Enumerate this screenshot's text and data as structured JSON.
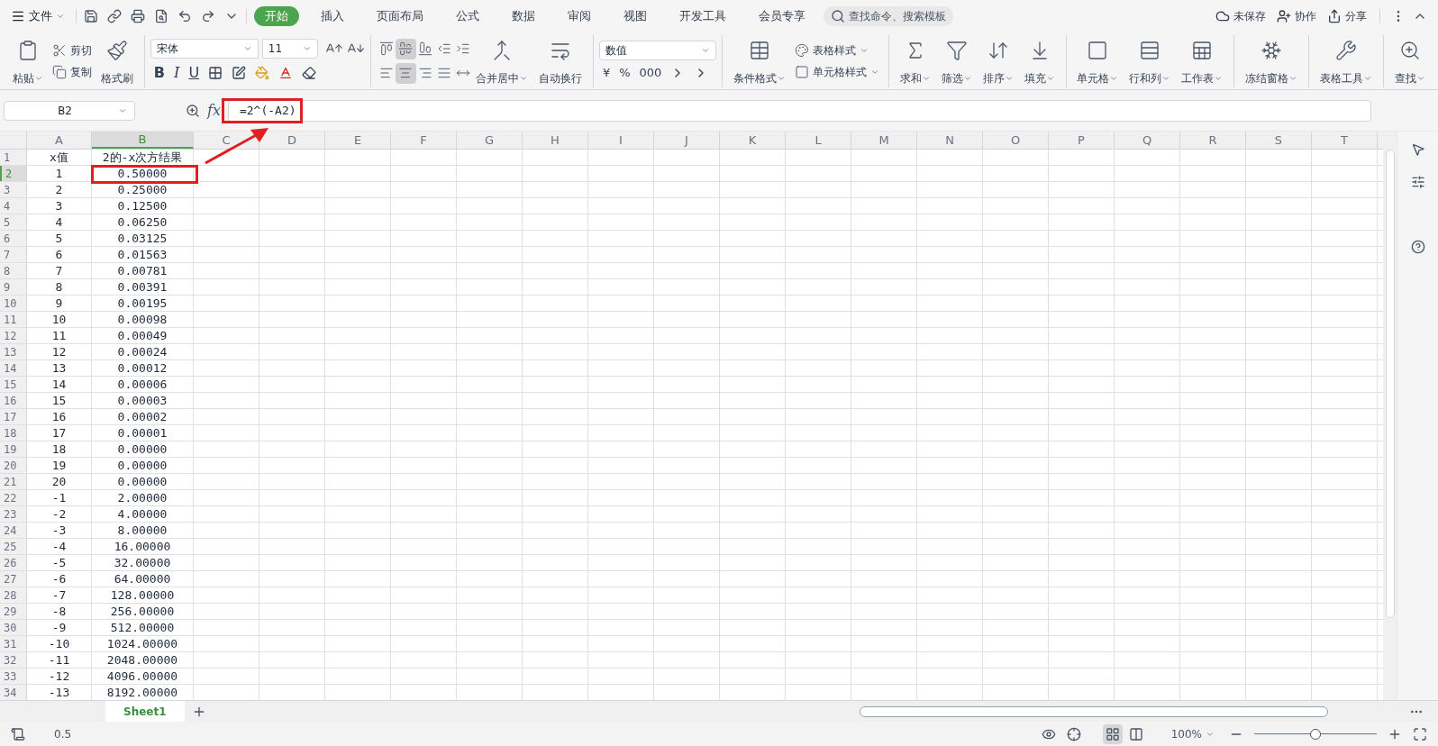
{
  "menu": {
    "file_label": "文件",
    "tabs": [
      {
        "label": "开始",
        "selected": true
      },
      {
        "label": "插入",
        "selected": false
      },
      {
        "label": "页面布局",
        "selected": false
      },
      {
        "label": "公式",
        "selected": false
      },
      {
        "label": "数据",
        "selected": false
      },
      {
        "label": "审阅",
        "selected": false
      },
      {
        "label": "视图",
        "selected": false
      },
      {
        "label": "开发工具",
        "selected": false
      },
      {
        "label": "会员专享",
        "selected": false
      }
    ],
    "search_placeholder": "查找命令、搜索模板",
    "actions": [
      "未保存",
      "协作",
      "分享"
    ]
  },
  "ribbon": {
    "clipboard": [
      "粘贴",
      "剪切",
      "复制",
      "格式刷"
    ],
    "font_name": "宋体",
    "font_size": "11",
    "text_styles": [
      "B",
      "I",
      "U"
    ],
    "alignment_buttons": [
      {
        "selected": false
      },
      {
        "selected": true
      },
      {
        "selected": false
      },
      {
        "selected": false
      },
      {
        "selected": false
      },
      {
        "selected": false
      },
      {
        "selected": true
      },
      {
        "selected": false
      },
      {
        "selected": false
      },
      {
        "selected": false
      }
    ],
    "alignment": [
      "合并居中",
      "自动换行"
    ],
    "number_format": "数值",
    "number_symbols": [
      "¥",
      "%",
      "000"
    ],
    "styles": [
      "条件格式",
      "表格样式",
      "单元格样式"
    ],
    "tools": [
      "求和",
      "筛选",
      "排序",
      "填充",
      "单元格",
      "行和列",
      "工作表",
      "冻结窗格",
      "表格工具",
      "查找"
    ]
  },
  "formula_bar": {
    "cell_ref": "B2",
    "fx_label": "fx",
    "formula": "=2^(-A2)"
  },
  "columns": [
    {
      "label": "A",
      "selected": false
    },
    {
      "label": "B",
      "selected": true
    },
    {
      "label": "C",
      "selected": false
    },
    {
      "label": "D",
      "selected": false
    },
    {
      "label": "E",
      "selected": false
    },
    {
      "label": "F",
      "selected": false
    },
    {
      "label": "G",
      "selected": false
    },
    {
      "label": "H",
      "selected": false
    },
    {
      "label": "I",
      "selected": false
    },
    {
      "label": "J",
      "selected": false
    },
    {
      "label": "K",
      "selected": false
    },
    {
      "label": "L",
      "selected": false
    },
    {
      "label": "M",
      "selected": false
    },
    {
      "label": "N",
      "selected": false
    },
    {
      "label": "O",
      "selected": false
    },
    {
      "label": "P",
      "selected": false
    },
    {
      "label": "Q",
      "selected": false
    },
    {
      "label": "R",
      "selected": false
    },
    {
      "label": "S",
      "selected": false
    },
    {
      "label": "T",
      "selected": false
    }
  ],
  "rows": [
    {
      "number": "1",
      "selected": false,
      "cells": [
        "x值",
        "2的-x次方结果"
      ]
    },
    {
      "number": "2",
      "selected": true,
      "cells": [
        "1",
        "0.50000"
      ]
    },
    {
      "number": "3",
      "selected": false,
      "cells": [
        "2",
        "0.25000"
      ]
    },
    {
      "number": "4",
      "selected": false,
      "cells": [
        "3",
        "0.12500"
      ]
    },
    {
      "number": "5",
      "selected": false,
      "cells": [
        "4",
        "0.06250"
      ]
    },
    {
      "number": "6",
      "selected": false,
      "cells": [
        "5",
        "0.03125"
      ]
    },
    {
      "number": "7",
      "selected": false,
      "cells": [
        "6",
        "0.01563"
      ]
    },
    {
      "number": "8",
      "selected": false,
      "cells": [
        "7",
        "0.00781"
      ]
    },
    {
      "number": "9",
      "selected": false,
      "cells": [
        "8",
        "0.00391"
      ]
    },
    {
      "number": "10",
      "selected": false,
      "cells": [
        "9",
        "0.00195"
      ]
    },
    {
      "number": "11",
      "selected": false,
      "cells": [
        "10",
        "0.00098"
      ]
    },
    {
      "number": "12",
      "selected": false,
      "cells": [
        "11",
        "0.00049"
      ]
    },
    {
      "number": "13",
      "selected": false,
      "cells": [
        "12",
        "0.00024"
      ]
    },
    {
      "number": "14",
      "selected": false,
      "cells": [
        "13",
        "0.00012"
      ]
    },
    {
      "number": "15",
      "selected": false,
      "cells": [
        "14",
        "0.00006"
      ]
    },
    {
      "number": "16",
      "selected": false,
      "cells": [
        "15",
        "0.00003"
      ]
    },
    {
      "number": "17",
      "selected": false,
      "cells": [
        "16",
        "0.00002"
      ]
    },
    {
      "number": "18",
      "selected": false,
      "cells": [
        "17",
        "0.00001"
      ]
    },
    {
      "number": "19",
      "selected": false,
      "cells": [
        "18",
        "0.00000"
      ]
    },
    {
      "number": "20",
      "selected": false,
      "cells": [
        "19",
        "0.00000"
      ]
    },
    {
      "number": "21",
      "selected": false,
      "cells": [
        "20",
        "0.00000"
      ]
    },
    {
      "number": "22",
      "selected": false,
      "cells": [
        "-1",
        "2.00000"
      ]
    },
    {
      "number": "23",
      "selected": false,
      "cells": [
        "-2",
        "4.00000"
      ]
    },
    {
      "number": "24",
      "selected": false,
      "cells": [
        "-3",
        "8.00000"
      ]
    },
    {
      "number": "25",
      "selected": false,
      "cells": [
        "-4",
        "16.00000"
      ]
    },
    {
      "number": "26",
      "selected": false,
      "cells": [
        "-5",
        "32.00000"
      ]
    },
    {
      "number": "27",
      "selected": false,
      "cells": [
        "-6",
        "64.00000"
      ]
    },
    {
      "number": "28",
      "selected": false,
      "cells": [
        "-7",
        "128.00000"
      ]
    },
    {
      "number": "29",
      "selected": false,
      "cells": [
        "-8",
        "256.00000"
      ]
    },
    {
      "number": "30",
      "selected": false,
      "cells": [
        "-9",
        "512.00000"
      ]
    },
    {
      "number": "31",
      "selected": false,
      "cells": [
        "-10",
        "1024.00000"
      ]
    },
    {
      "number": "32",
      "selected": false,
      "cells": [
        "-11",
        "2048.00000"
      ]
    },
    {
      "number": "33",
      "selected": false,
      "cells": [
        "-12",
        "4096.00000"
      ]
    },
    {
      "number": "34",
      "selected": false,
      "cells": [
        "-13",
        "8192.00000"
      ]
    }
  ],
  "sheet_tabs": [
    {
      "label": "Sheet1",
      "selected": true
    }
  ],
  "status_bar": {
    "value": "0.5",
    "views": [
      {
        "selected": true
      },
      {
        "selected": false
      }
    ],
    "zoom": "100%",
    "zoom_slider": {
      "level": 0.5
    }
  }
}
